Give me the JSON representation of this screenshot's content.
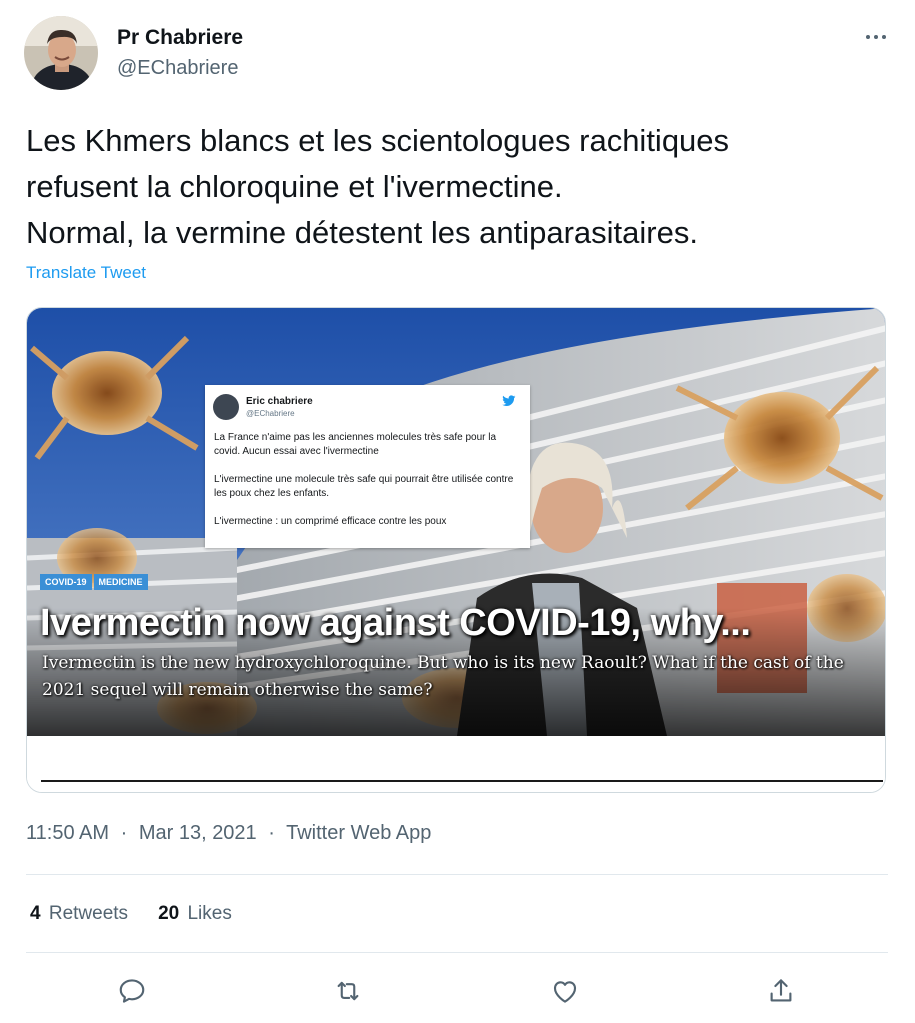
{
  "author": {
    "display_name": "Pr Chabriere",
    "handle": "@EChabriere"
  },
  "tweet": {
    "text": "Les Khmers blancs et les scientologues rachitiques\nrefusent la chloroquine et l'ivermectine.\nNormal, la vermine détestent les antiparasitaires.",
    "translate_label": "Translate Tweet"
  },
  "card": {
    "embedded_tweet": {
      "name": "Eric chabriere",
      "handle": "@EChabriere",
      "paragraphs": [
        "La France n'aime pas les anciennes molecules très safe pour la covid. Aucun  essai avec l'ivermectine",
        "L'ivermectine une molecule très safe qui pourrait être utilisée contre les poux chez les enfants.",
        "L'ivermectine : un comprimé efficace contre les poux"
      ]
    },
    "tags": [
      "COVID-19",
      "MEDICINE"
    ],
    "headline": "Ivermectin now against COVID-19, why...",
    "subline": "Ivermectin is the new hydroxychloroquine. But who is its new Raoult? What if the cast of the 2021 sequel will remain otherwise the same?"
  },
  "meta": {
    "time": "11:50 AM",
    "date": "Mar 13, 2021",
    "source": "Twitter Web App",
    "separator": "·"
  },
  "stats": {
    "retweets_count": "4",
    "retweets_label": "Retweets",
    "likes_count": "20",
    "likes_label": "Likes"
  },
  "colors": {
    "link": "#1d9bf0",
    "secondary_text": "#536471",
    "tag_bg": "#3a8fd6"
  },
  "icons": [
    "more-icon",
    "reply-icon",
    "retweet-icon",
    "like-icon",
    "share-icon",
    "twitter-bird-icon"
  ]
}
